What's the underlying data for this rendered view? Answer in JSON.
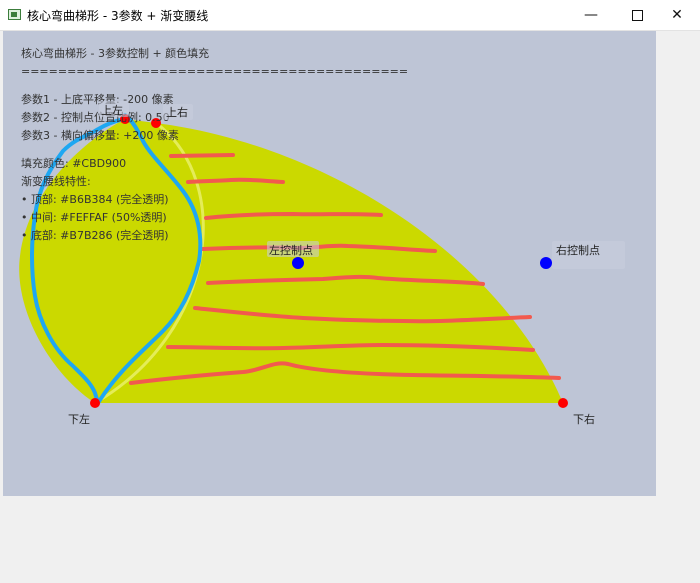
{
  "window": {
    "title": "核心弯曲梯形 - 3参数 + 渐变腰线",
    "minimize_glyph": "—",
    "close_glyph": "✕"
  },
  "info": {
    "heading": "核心弯曲梯形 - 3参数控制 + 颜色填充",
    "separator": "==========================================",
    "param1": "参数1 - 上底平移量: -200 像素",
    "param2": "参数2 - 控制点位置比例: 0.50",
    "param3": "参数3 - 横向偏移量: +200 像素",
    "fill_color": "填充颜色: #CBD900",
    "gradient_title": "渐变腰线特性:",
    "top": "• 顶部: #B6B384 (完全透明)",
    "middle": "• 中间: #FEFFAF (50%透明)",
    "bottom": "• 底部: #B7B286 (完全透明)"
  },
  "points": {
    "top_left": "上左",
    "top_right": "上右",
    "left_control": "左控制点",
    "right_control": "右控制点",
    "bottom_left": "下左",
    "bottom_right": "下右"
  },
  "colors": {
    "canvas_bg": "#BEC5D6",
    "shape_fill": "#CBD900",
    "vertex": "#FF0000",
    "control": "#0000FF",
    "annotation_blue": "#1EA7F2",
    "annotation_red": "#F25A4E"
  }
}
